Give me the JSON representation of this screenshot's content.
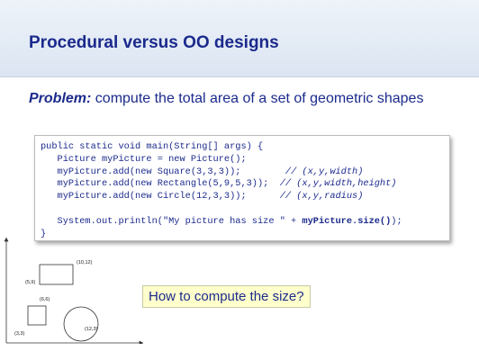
{
  "slide": {
    "title": "Procedural versus OO designs",
    "problem_label": "Problem:",
    "problem_text": " compute the total area of a set of geometric shapes",
    "question": "How to compute the size?"
  },
  "code": {
    "l1": "public static void main(String[] args) {",
    "l2": "   Picture myPicture = new Picture();",
    "l3a": "   myPicture.add(new Square(3,3,3));        ",
    "l3b": "// (x,y,width)",
    "l4a": "   myPicture.add(new Rectangle(5,9,5,3));  ",
    "l4b": "// (x,y,width,height)",
    "l5a": "   myPicture.add(new Circle(12,3,3));      ",
    "l5b": "// (x,y,radius)",
    "l6a": "   System.out.println(\"My picture has size \" + ",
    "l6b": "myPicture.size()",
    "l6c": ");",
    "l7": "}"
  },
  "diagram": {
    "labels": {
      "rect_top_right": "(10,12)",
      "rect_bottom_left": "(5,9)",
      "square_top_right": "(6,6)",
      "square_bottom_left": "(3,3)",
      "circle_center": "(12,3)"
    }
  }
}
